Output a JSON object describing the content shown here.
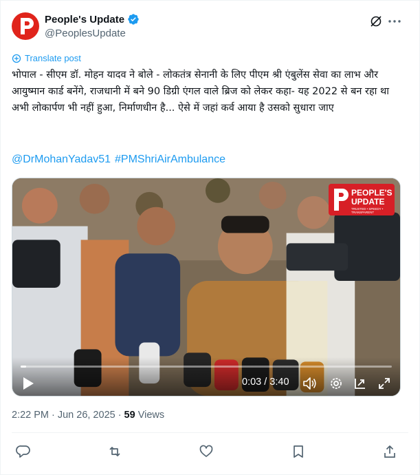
{
  "author": {
    "display_name": "People's Update",
    "handle": "@PeoplesUpdate",
    "verified": true,
    "avatar_color": "#e0241b"
  },
  "translate": {
    "label": "Translate post"
  },
  "post": {
    "text": "भोपाल - सीएम डॉ. मोहन यादव ने बोले - लोकतंत्र सेनानी के लिए पीएम श्री एंबुलेंस सेवा का लाभ और आयुष्मान कार्ड बनेंगे, राजधानी में बने 90 डिग्री एंगल वाले ब्रिज को लेकर कहा- यह 2022 से बन रहा था अभी लोकार्पण भी नहीं हुआ, निर्माणधीन है... ऐसे में जहां कर्व आया है उसको सुधारा जाए",
    "hashtags": [
      "@DrMohanYadav51",
      "#PMShriAirAmbulance"
    ]
  },
  "video": {
    "watermark": "PEOPLE'S UPDATE",
    "watermark_tagline": "TRUSTED • SPEEDY • TRANSPARENT",
    "time": "0:03 / 3:40",
    "progress": 0.014
  },
  "meta": {
    "time": "2:22 PM",
    "date": "Jun 26, 2025",
    "separator": "·",
    "views_count": "59",
    "views_label": "Views"
  },
  "colors": {
    "accent": "#1d9bf0",
    "text": "#0f1419",
    "muted": "#536471",
    "brand_red": "#d71f26"
  },
  "icons": {
    "grok": "grok-icon",
    "more": "more-horizontal-icon",
    "translate": "translate-icon",
    "reply": "reply-icon",
    "repost": "repost-icon",
    "like": "heart-icon",
    "bookmark": "bookmark-icon",
    "share": "share-icon"
  }
}
